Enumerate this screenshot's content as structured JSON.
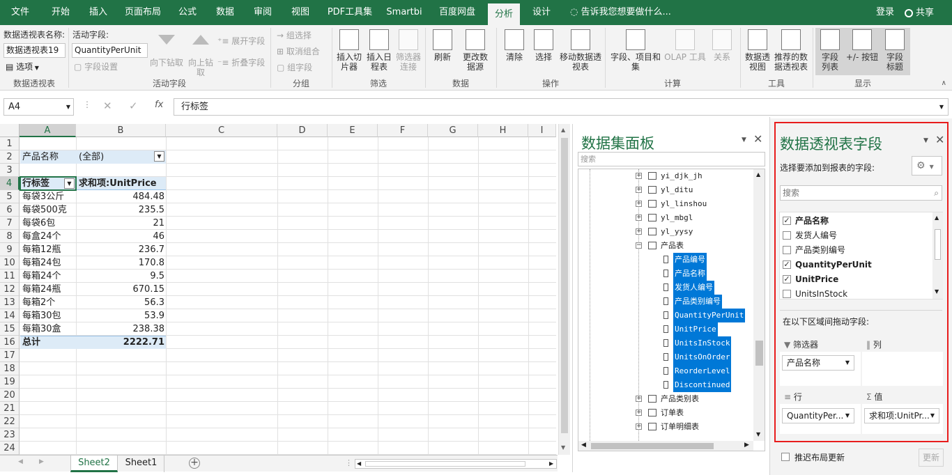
{
  "tabs": [
    "文件",
    "开始",
    "插入",
    "页面布局",
    "公式",
    "数据",
    "审阅",
    "视图",
    "PDF工具集",
    "Smartbi",
    "百度网盘",
    "分析",
    "设计"
  ],
  "tell_me": "告诉我您想要做什么...",
  "login": "登录",
  "share": "共享",
  "ribbon": {
    "pivot_name_label": "数据透视表名称:",
    "pivot_name_value": "数据透视表19",
    "options": "选项",
    "active_field_label": "活动字段:",
    "active_field_value": "QuantityPerUnit",
    "field_settings": "字段设置",
    "drill_down": "向下钻取",
    "drill_up": "向上钻取",
    "expand_field": "展开字段",
    "collapse_field": "折叠字段",
    "group_selection": "组选择",
    "ungroup": "取消组合",
    "group_field": "组字段",
    "insert_slicer": "插入切片器",
    "insert_timeline": "插入日程表",
    "filter_connections": "筛选器连接",
    "refresh": "刷新",
    "change_source": "更改数据源",
    "clear": "清除",
    "select": "选择",
    "move_pivot": "移动数据透视表",
    "fields_items": "字段、项目和集",
    "olap_tools": "OLAP 工具",
    "relationships": "关系",
    "pivot_chart": "数据透视图",
    "recommended": "推荐的数据透视表",
    "field_list": "字段列表",
    "plus_minus": "+/- 按钮",
    "field_headers": "字段标题",
    "groups": [
      "数据透视表",
      "活动字段",
      "分组",
      "筛选",
      "数据",
      "操作",
      "计算",
      "工具",
      "显示"
    ]
  },
  "formula_bar": {
    "name_box": "A4",
    "fx": "fx",
    "content": "行标签"
  },
  "sheet": {
    "columns": [
      "A",
      "B",
      "C",
      "D",
      "E",
      "F",
      "G",
      "H",
      "I"
    ],
    "rows": [
      "1",
      "2",
      "3",
      "4",
      "5",
      "6",
      "7",
      "8",
      "9",
      "10",
      "11",
      "12",
      "13",
      "14",
      "15",
      "16",
      "17",
      "18",
      "19",
      "20",
      "21",
      "22",
      "23",
      "24"
    ],
    "filter_label": "产品名称",
    "filter_value": "(全部)",
    "row_label_header": "行标签",
    "value_header": "求和项:UnitPrice",
    "data": [
      {
        "name": "每袋3公斤",
        "value": "484.48"
      },
      {
        "name": "每袋500克",
        "value": "235.5"
      },
      {
        "name": "每袋6包",
        "value": "21"
      },
      {
        "name": "每盒24个",
        "value": "46"
      },
      {
        "name": "每箱12瓶",
        "value": "236.7"
      },
      {
        "name": "每箱24包",
        "value": "170.8"
      },
      {
        "name": "每箱24个",
        "value": "9.5"
      },
      {
        "name": "每箱24瓶",
        "value": "670.15"
      },
      {
        "name": "每箱2个",
        "value": "56.3"
      },
      {
        "name": "每箱30包",
        "value": "53.9"
      },
      {
        "name": "每箱30盒",
        "value": "238.38"
      }
    ],
    "total_label": "总计",
    "total_value": "2222.71",
    "sheet_tabs": [
      "Sheet2",
      "Sheet1"
    ]
  },
  "data_panel": {
    "title": "数据集面板",
    "search_placeholder": "搜索",
    "tables": [
      "yi_djk_jh",
      "yl_ditu",
      "yl_linshou",
      "yl_mbgl",
      "yl_yysy",
      "产品表"
    ],
    "fields": [
      "产品编号",
      "产品名称",
      "发货人编号",
      "产品类别编号",
      "QuantityPerUnit",
      "UnitPrice",
      "UnitsInStock",
      "UnitsOnOrder",
      "ReorderLevel",
      "Discontinued"
    ],
    "tables_after": [
      "产品类别表",
      "订单表",
      "订单明细表"
    ]
  },
  "pivot_panel": {
    "title": "数据透视表字段",
    "subtitle": "选择要添加到报表的字段:",
    "search_placeholder": "搜索",
    "fields": [
      {
        "name": "产品名称",
        "checked": true,
        "bold": true
      },
      {
        "name": "发货人编号",
        "checked": false,
        "bold": false
      },
      {
        "name": "产品类别编号",
        "checked": false,
        "bold": false
      },
      {
        "name": "QuantityPerUnit",
        "checked": true,
        "bold": true
      },
      {
        "name": "UnitPrice",
        "checked": true,
        "bold": true
      },
      {
        "name": "UnitsInStock",
        "checked": false,
        "bold": false
      }
    ],
    "drag_label": "在以下区域间拖动字段:",
    "filters_label": "筛选器",
    "columns_label": "列",
    "rows_label": "行",
    "values_label": "值",
    "filter_item": "产品名称",
    "row_item": "QuantityPer...",
    "value_item": "求和项:UnitPr...",
    "defer_label": "推迟布局更新",
    "update_label": "更新"
  }
}
